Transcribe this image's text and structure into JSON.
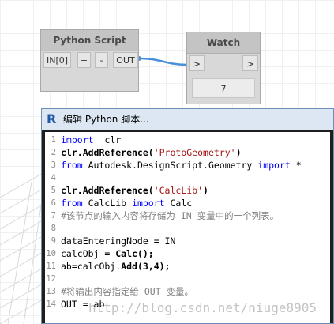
{
  "python_node": {
    "title": "Python Script",
    "in_port": "IN[0]",
    "add_port": "+",
    "remove_port": "-",
    "out_port": "OUT"
  },
  "watch_node": {
    "title": "Watch",
    "in_port": ">",
    "out_port": ">",
    "value": "7"
  },
  "editor": {
    "title": "编辑 Python 脚本...",
    "lines": [
      {
        "n": "1",
        "segs": [
          [
            "kw",
            "import"
          ],
          [
            "",
            "  clr"
          ]
        ]
      },
      {
        "n": "2",
        "segs": [
          [
            "fn",
            "clr.AddReference("
          ],
          [
            "str",
            "'ProtoGeometry'"
          ],
          [
            "fn",
            ")"
          ]
        ]
      },
      {
        "n": "3",
        "segs": [
          [
            "kw",
            "from"
          ],
          [
            "",
            " Autodesk.DesignScript.Geometry "
          ],
          [
            "kw",
            "import"
          ],
          [
            "",
            " *"
          ]
        ]
      },
      {
        "n": "4",
        "segs": []
      },
      {
        "n": "5",
        "segs": [
          [
            "fn",
            "clr.AddReference("
          ],
          [
            "str",
            "'CalcLib'"
          ],
          [
            "fn",
            ")"
          ]
        ]
      },
      {
        "n": "6",
        "segs": [
          [
            "kw",
            "from"
          ],
          [
            "",
            " CalcLib "
          ],
          [
            "kw",
            "import"
          ],
          [
            "",
            " Calc"
          ]
        ]
      },
      {
        "n": "7",
        "segs": [
          [
            "cm",
            "#该节点的输入内容将存储为 IN 变量中的一个列表。"
          ]
        ]
      },
      {
        "n": "8",
        "segs": []
      },
      {
        "n": "9",
        "segs": [
          [
            "",
            "dataEnteringNode = IN"
          ]
        ]
      },
      {
        "n": "10",
        "segs": [
          [
            "",
            "calcObj = "
          ],
          [
            "fn",
            "Calc();"
          ]
        ]
      },
      {
        "n": "11",
        "segs": [
          [
            "",
            "ab=calcObj."
          ],
          [
            "fn",
            "Add(3,4);"
          ]
        ]
      },
      {
        "n": "12",
        "segs": []
      },
      {
        "n": "13",
        "segs": [
          [
            "cm",
            "#将输出内容指定给 OUT 变量。"
          ]
        ]
      },
      {
        "n": "14",
        "segs": [
          [
            "",
            "OUT = ab"
          ]
        ]
      }
    ]
  },
  "watermark": "http://blog.csdn.net/niuge8905"
}
